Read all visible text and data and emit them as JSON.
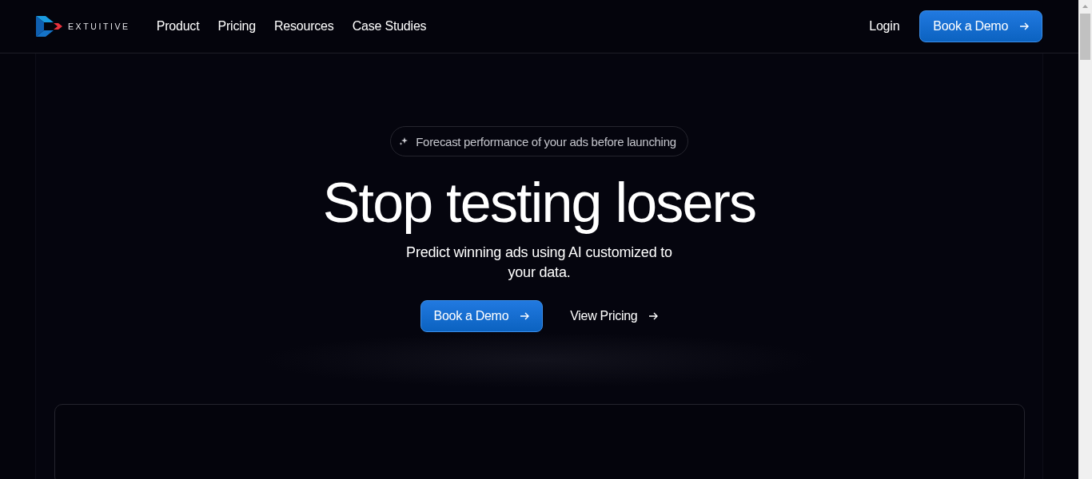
{
  "nav": {
    "logo_text": "EXTUITIVE",
    "links": [
      {
        "label": "Product"
      },
      {
        "label": "Pricing"
      },
      {
        "label": "Resources"
      },
      {
        "label": "Case Studies"
      }
    ],
    "login": "Login",
    "cta": "Book a Demo"
  },
  "hero": {
    "badge": "Forecast performance of your ads before launching",
    "title": "Stop testing losers",
    "subtitle": "Predict winning ads using AI customized to your data.",
    "primary_button": "Book a Demo",
    "secondary_button": "View Pricing"
  }
}
